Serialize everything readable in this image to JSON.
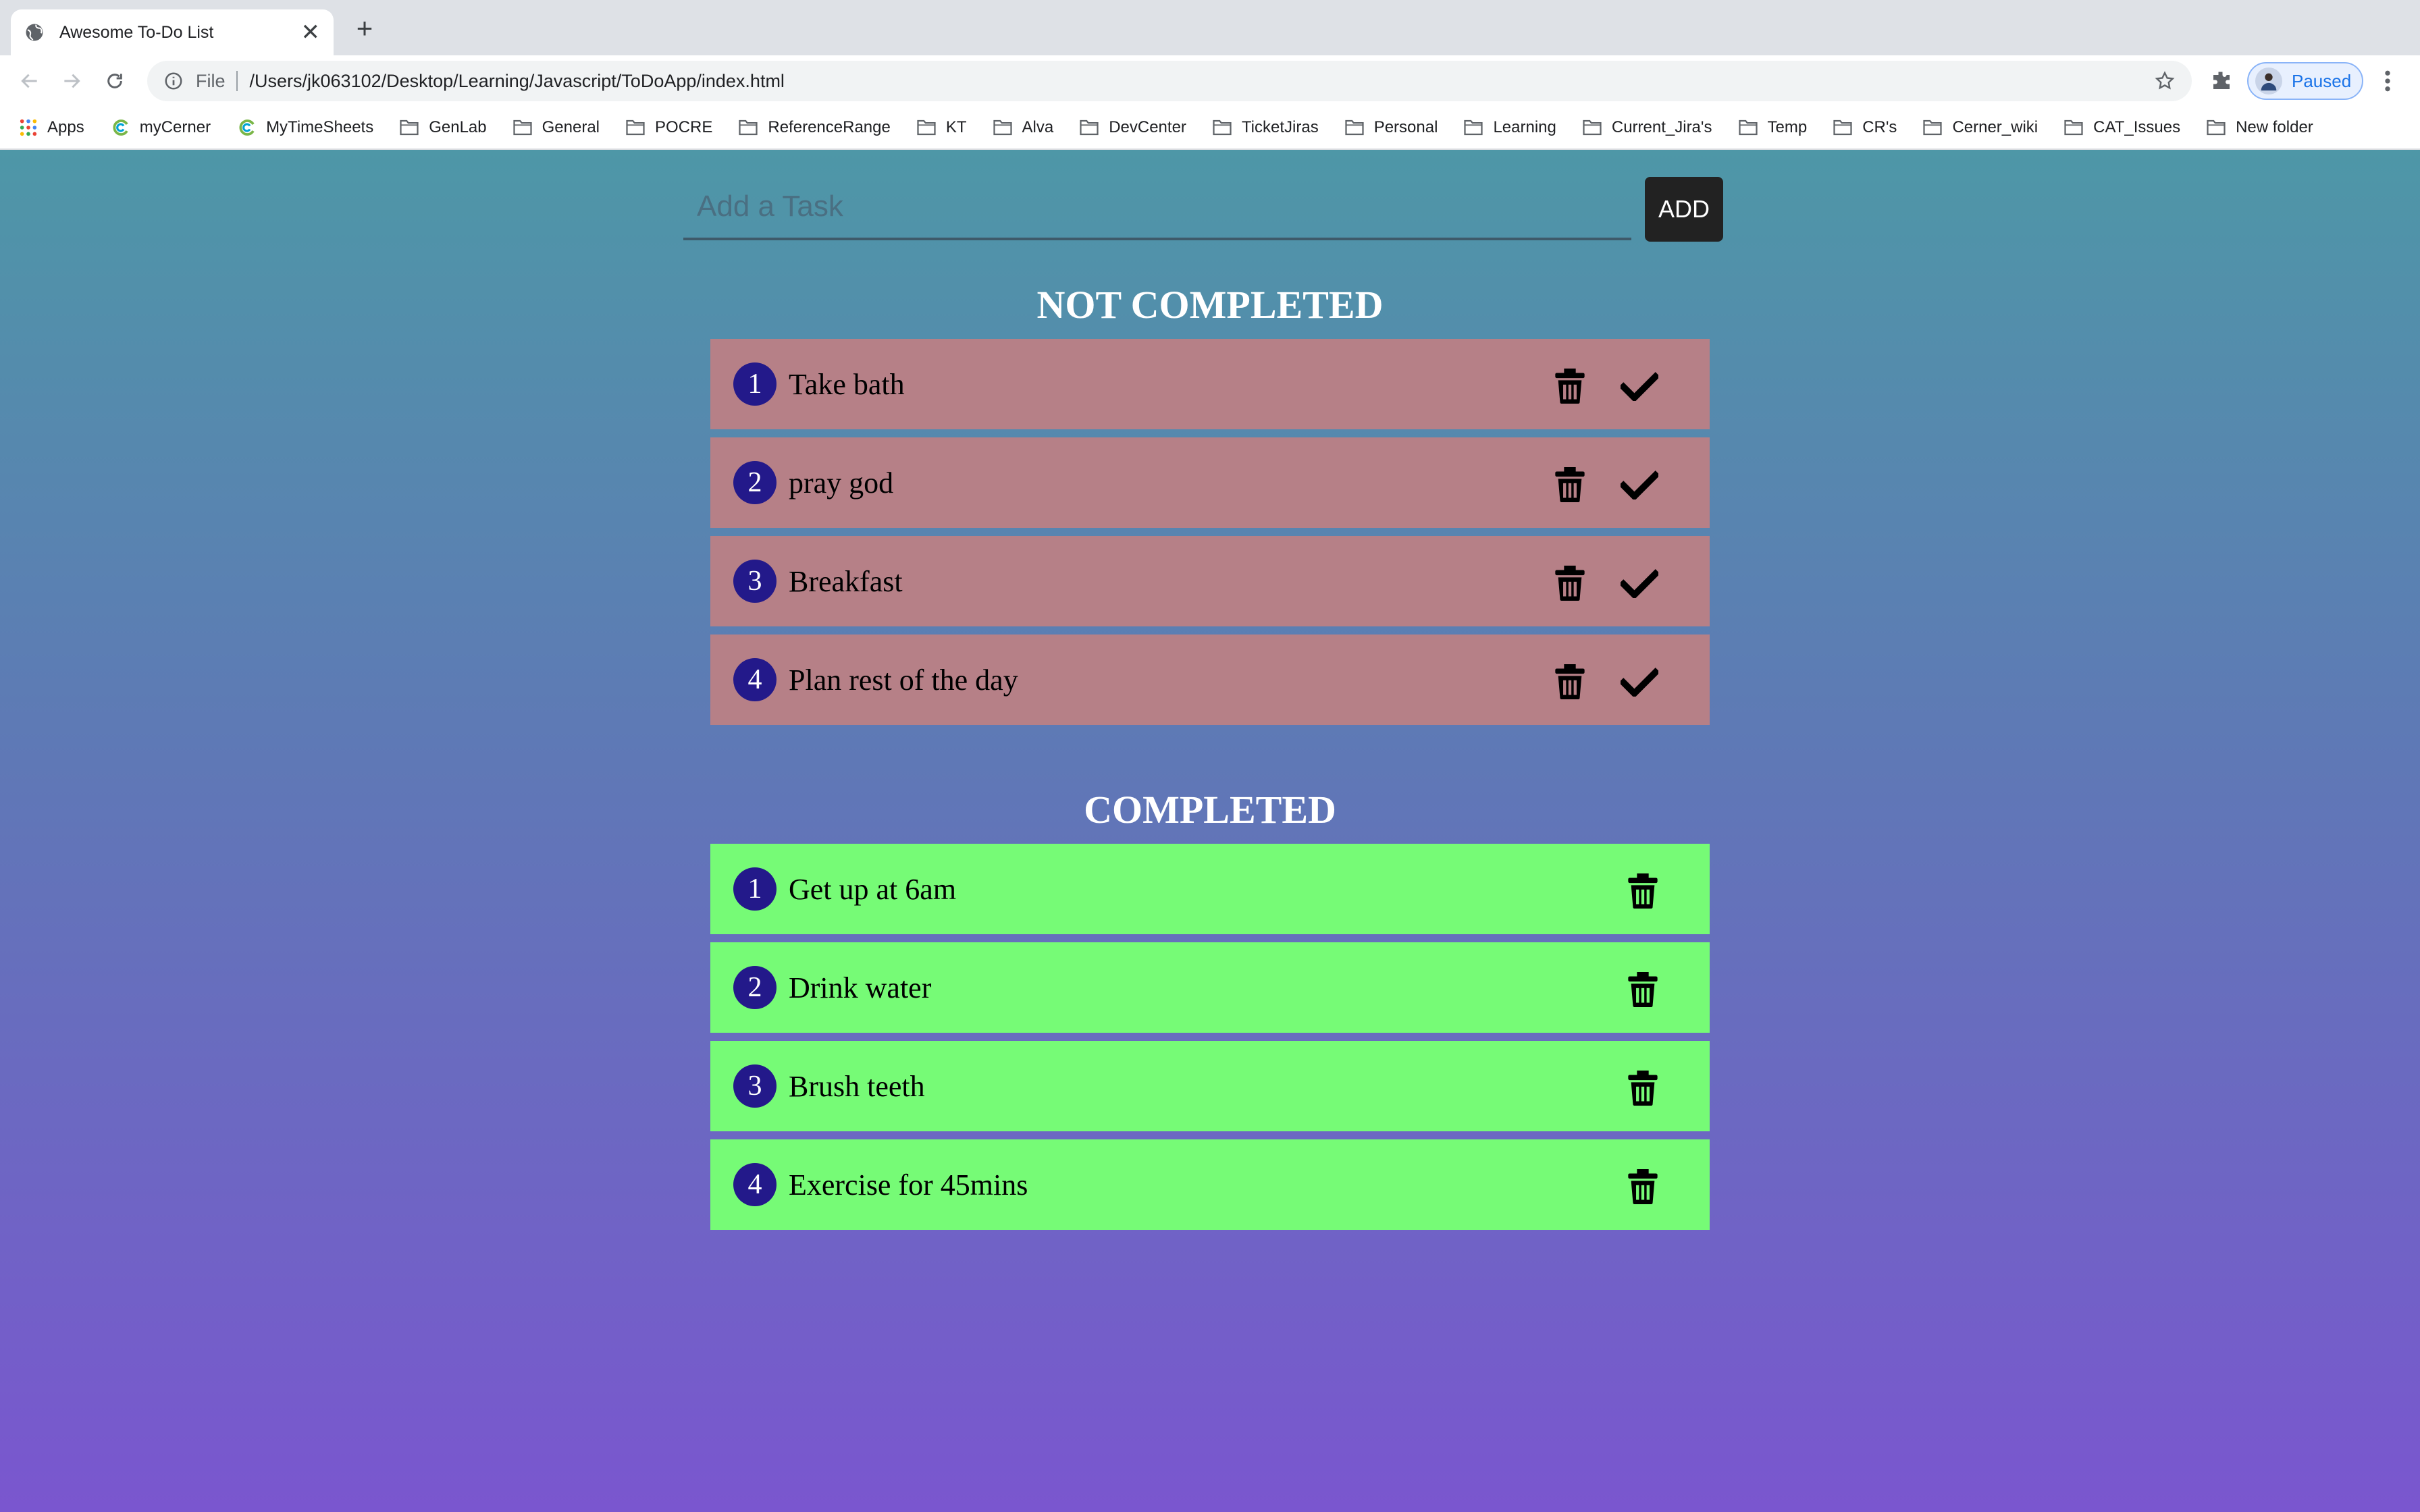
{
  "browser": {
    "tab_title": "Awesome To-Do List",
    "scheme_label": "File",
    "url": "/Users/jk063102/Desktop/Learning/Javascript/ToDoApp/index.html",
    "profile_status": "Paused",
    "bookmarks": [
      "Apps",
      "myCerner",
      "MyTimeSheets",
      "GenLab",
      "General",
      "POCRE",
      "ReferenceRange",
      "KT",
      "Alva",
      "DevCenter",
      "TicketJiras",
      "Personal",
      "Learning",
      "Current_Jira's",
      "Temp",
      "CR's",
      "Cerner_wiki",
      "CAT_Issues",
      "New folder"
    ]
  },
  "app": {
    "input_placeholder": "Add a Task",
    "input_value": "",
    "add_label": "ADD",
    "not_completed_title": "NOT COMPLETED",
    "completed_title": "COMPLETED",
    "not_completed": [
      {
        "num": "1",
        "text": "Take bath"
      },
      {
        "num": "2",
        "text": "pray god"
      },
      {
        "num": "3",
        "text": "Breakfast"
      },
      {
        "num": "4",
        "text": "Plan rest of the day"
      }
    ],
    "completed": [
      {
        "num": "1",
        "text": "Get up at 6am"
      },
      {
        "num": "2",
        "text": "Drink water"
      },
      {
        "num": "3",
        "text": "Brush teeth"
      },
      {
        "num": "4",
        "text": "Exercise for 45mins"
      }
    ]
  },
  "colors": {
    "not_completed_bg": "#b68087",
    "completed_bg": "#76fb76",
    "badge": "#23198a",
    "gradient_top": "#4e97a7",
    "gradient_bottom": "#7a56cf"
  },
  "icons": {
    "delete": "trash-icon",
    "complete": "checkmark-icon"
  }
}
